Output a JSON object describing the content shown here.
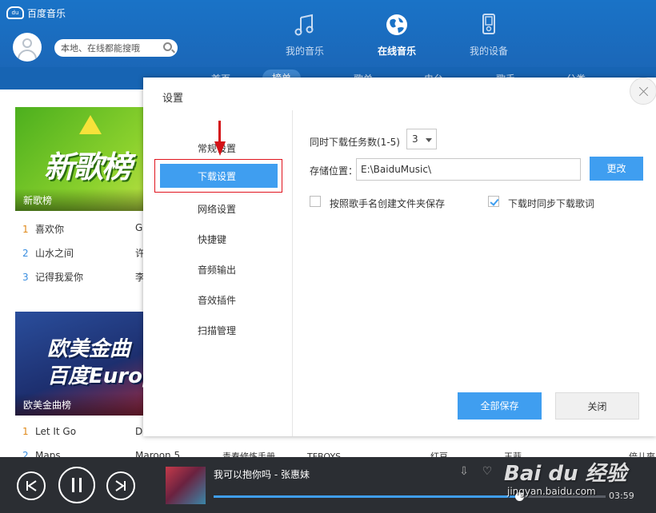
{
  "app": {
    "title": "百度音乐",
    "logo_text": "du"
  },
  "search": {
    "placeholder": "本地、在线都能搜哦"
  },
  "nav": [
    {
      "label": "我的音乐",
      "icon": "music-note-icon"
    },
    {
      "label": "在线音乐",
      "icon": "globe-icon"
    },
    {
      "label": "我的设备",
      "icon": "device-icon"
    }
  ],
  "subnav": [
    "首页",
    "榜单",
    "歌单",
    "电台",
    "歌手",
    "分类"
  ],
  "background": {
    "chart1": {
      "cover_text": "新歌榜",
      "caption": "新歌榜",
      "songs": [
        {
          "num": "1",
          "title": "喜欢你",
          "artist": "G"
        },
        {
          "num": "2",
          "title": "山水之间",
          "artist": "许"
        },
        {
          "num": "3",
          "title": "记得我爱你",
          "artist": "李"
        }
      ]
    },
    "chart2": {
      "cover_text": "欧美金曲",
      "cover_text2": "百度Europe Americ",
      "caption": "欧美金曲榜",
      "songs": [
        {
          "num": "1",
          "title": "Let It Go",
          "artist": "D"
        },
        {
          "num": "2",
          "title": "Maps",
          "artist": "Maroon 5"
        }
      ]
    },
    "col2_songs": [
      {
        "title": "青春修炼手册",
        "artist": "TFBOYS"
      },
      {
        "title": "红豆",
        "artist": "王菲"
      },
      {
        "title": "倍儿爽",
        "artist": ""
      }
    ]
  },
  "dialog": {
    "title": "设置",
    "menu": [
      "常规设置",
      "下载设置",
      "网络设置",
      "快捷键",
      "音频输出",
      "音效插件",
      "扫描管理"
    ],
    "selected_index": 1,
    "concurrent_label": "同时下载任务数(1-5)",
    "concurrent_value": "3",
    "storage_label": "存储位置：",
    "storage_path": "E:\\BaiduMusic\\",
    "change_button": "更改",
    "options": [
      {
        "label": "按照歌手名创建文件夹保存",
        "checked": false
      },
      {
        "label": "下载时同步下载歌词",
        "checked": true
      }
    ],
    "save_all_button": "全部保存",
    "close_button": "关闭"
  },
  "player": {
    "track": "我可以抱你吗 - 张惠妹",
    "time": "03:59",
    "progress": 0.78
  },
  "watermark": {
    "brand": "Bai du 经验",
    "url": "jingyan.baidu.com"
  },
  "colors": {
    "accent": "#3f9ef0",
    "header": "#1a73c7",
    "annotation": "#e0141e"
  }
}
